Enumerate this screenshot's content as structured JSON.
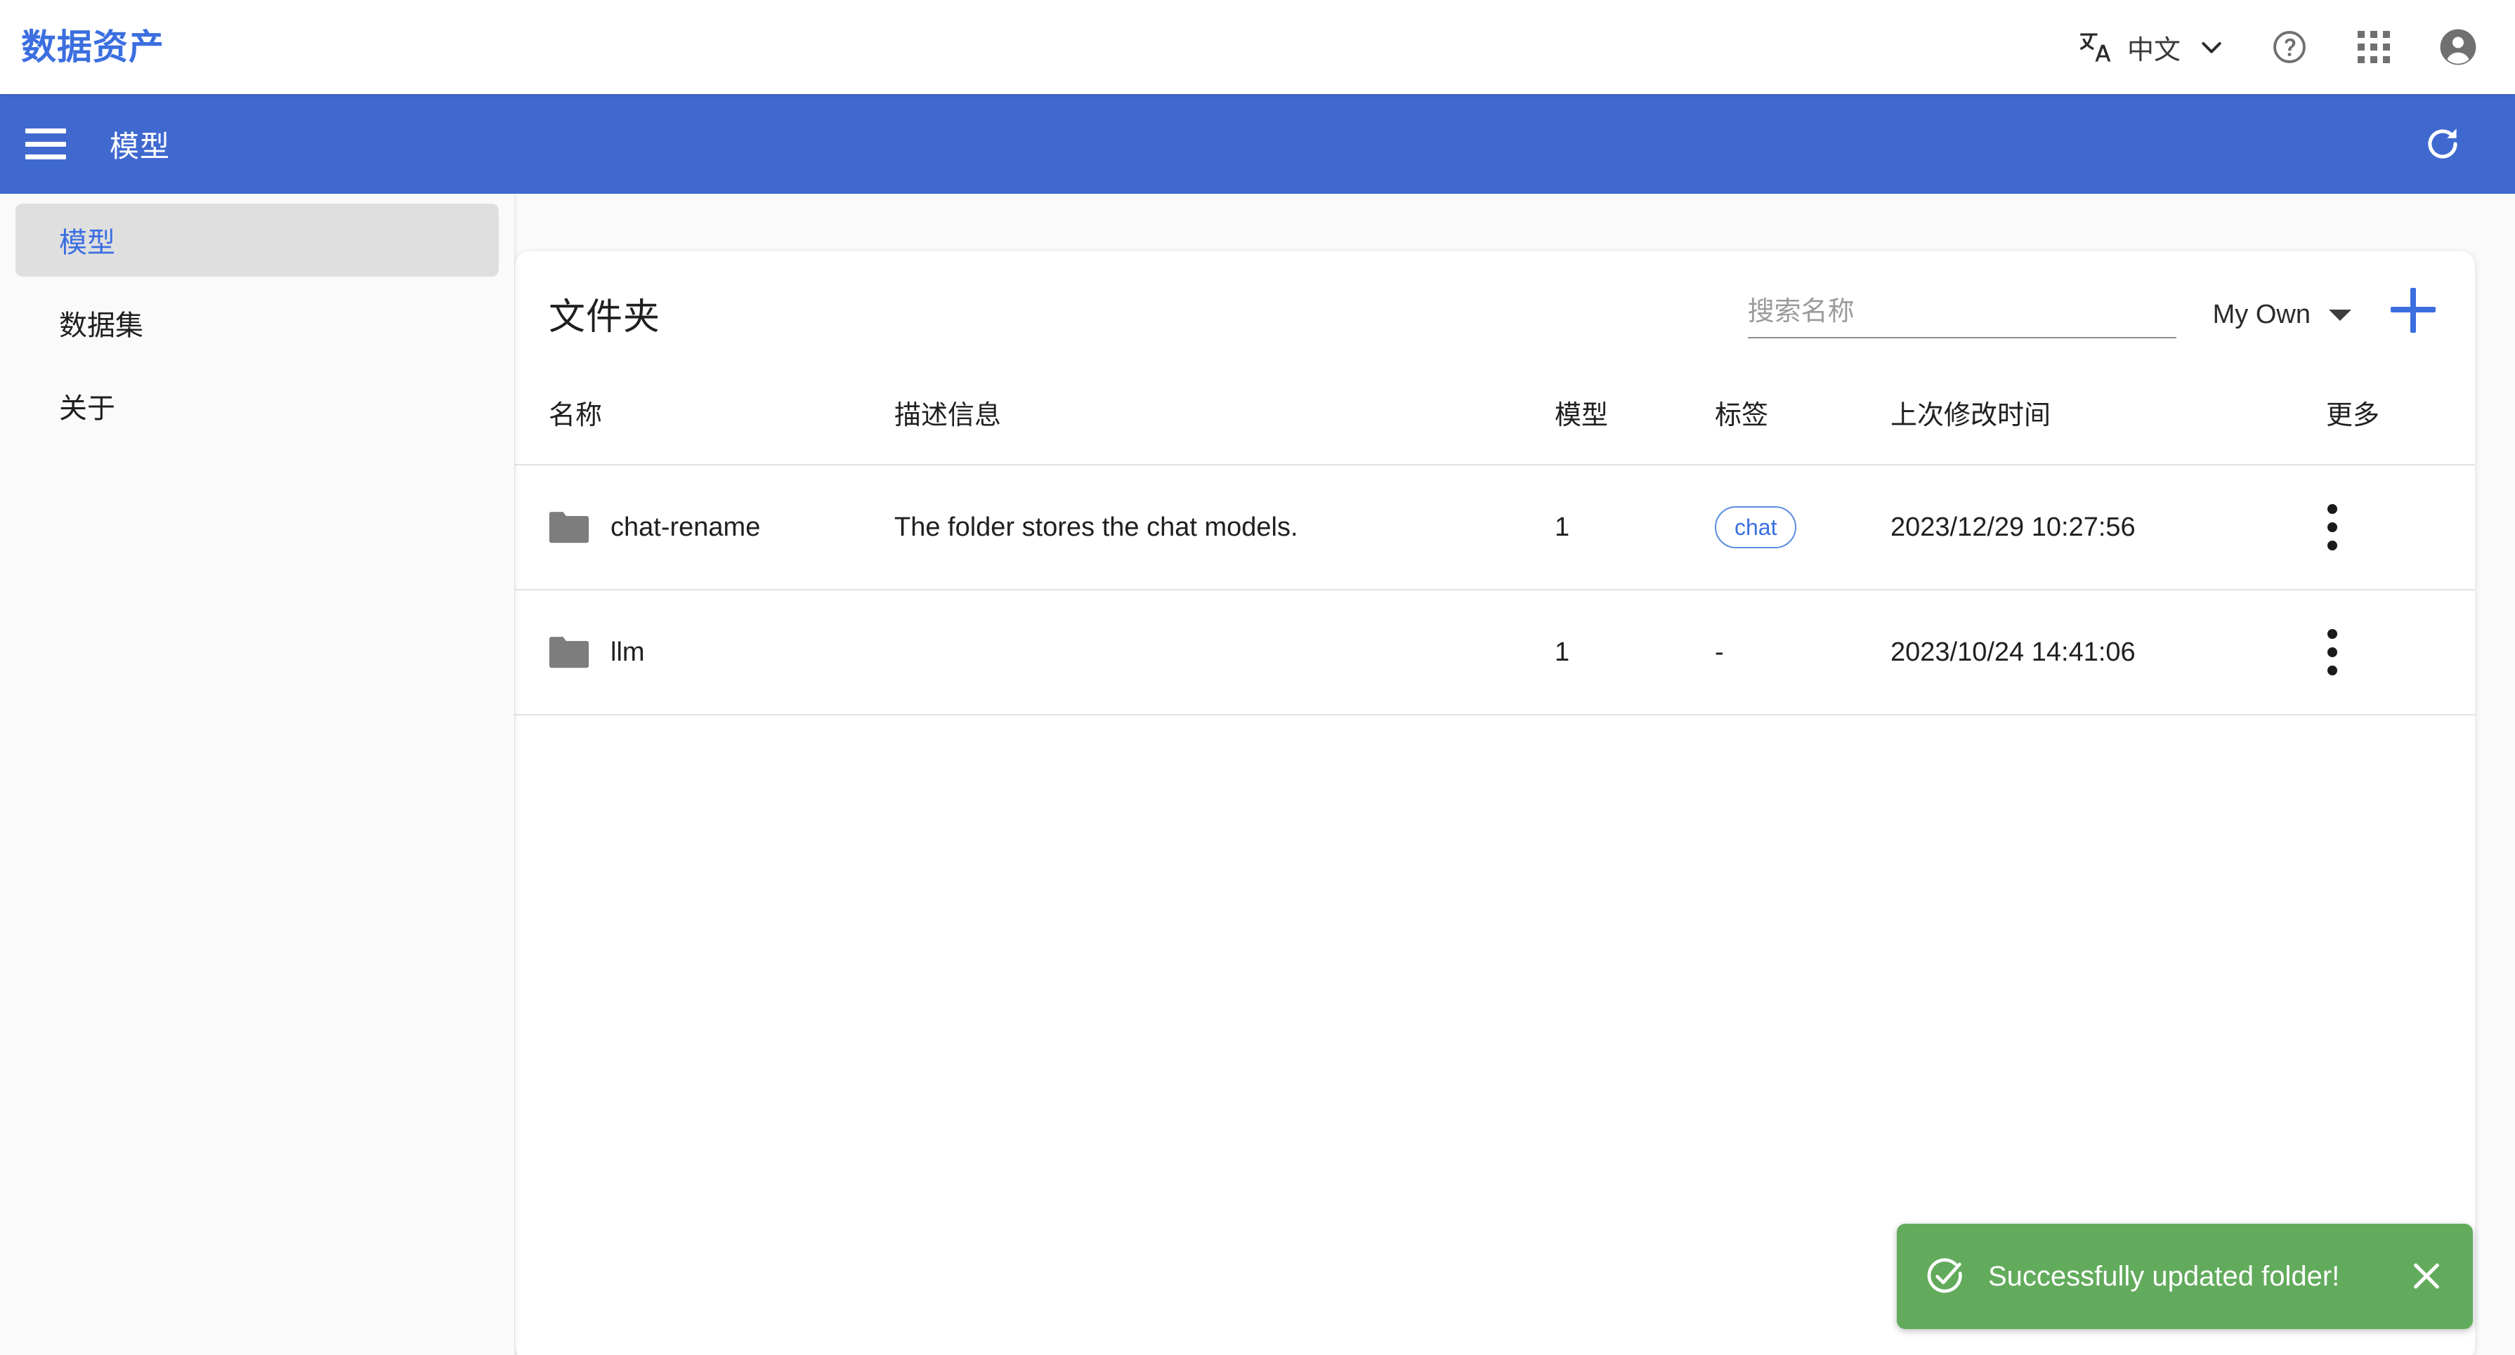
{
  "topbar": {
    "brand": "数据资产",
    "language_label": "中文",
    "translate_icon": "translate-icon",
    "chevron_icon": "chevron-down-icon",
    "help_icon": "help-circle-icon",
    "apps_icon": "apps-grid-icon",
    "account_icon": "account-circle-icon"
  },
  "appbar": {
    "menu_icon": "hamburger-menu-icon",
    "title": "模型",
    "refresh_icon": "refresh-icon",
    "background_color": "#4069d0"
  },
  "sidebar": {
    "items": [
      {
        "label": "模型",
        "active": true
      },
      {
        "label": "数据集",
        "active": false
      },
      {
        "label": "关于",
        "active": false
      }
    ]
  },
  "main": {
    "card_title": "文件夹",
    "search": {
      "value": "",
      "placeholder": "搜索名称"
    },
    "scope_select": {
      "value": "My Own",
      "icon": "caret-down-icon"
    },
    "add_button": {
      "label": "+",
      "icon": "plus-icon",
      "color": "#3b6fe0"
    },
    "table": {
      "columns": [
        "名称",
        "描述信息",
        "模型",
        "标签",
        "上次修改时间",
        "更多"
      ],
      "rows": [
        {
          "icon": "folder-icon",
          "name": "chat-rename",
          "description": "The folder stores the chat models.",
          "models": "1",
          "tag": "chat",
          "has_tag": true,
          "modified": "2023/12/29 10:27:56",
          "more_icon": "kebab-menu-icon"
        },
        {
          "icon": "folder-icon",
          "name": "llm",
          "description": "",
          "models": "1",
          "tag": "-",
          "has_tag": false,
          "modified": "2023/10/24 14:41:06",
          "more_icon": "kebab-menu-icon"
        }
      ]
    }
  },
  "toast": {
    "message": "Successfully updated folder!",
    "icon": "check-circle-icon",
    "close_icon": "close-icon",
    "background_color": "#62ab5c"
  }
}
